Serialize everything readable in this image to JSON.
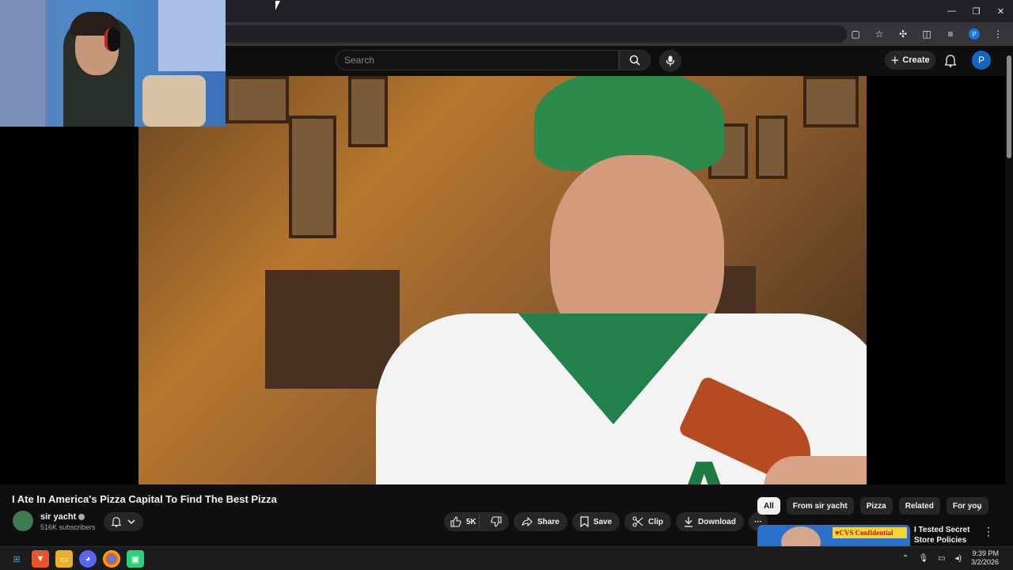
{
  "browser": {
    "window_controls": [
      "—",
      "❐",
      "✕"
    ]
  },
  "youtube": {
    "search_placeholder": "Search",
    "create_label": "Create",
    "avatar_letter": "P"
  },
  "video": {
    "title": "I Ate In America's Pizza Capital To Find The Best Pizza",
    "jersey_letter": "A"
  },
  "channel": {
    "name": "sir yacht",
    "subscribers": "516K subscribers"
  },
  "actions": {
    "likes": "5K",
    "share": "Share",
    "save": "Save",
    "clip": "Clip",
    "download": "Download",
    "more": "···"
  },
  "chips": [
    "All",
    "From sir yacht",
    "Pizza",
    "Related",
    "For you"
  ],
  "recommendation": {
    "title": "I Tested Secret Store Policies",
    "thumb_badge": "♥CVS Confidential"
  },
  "taskbar": {
    "time": "9:39 PM",
    "date": "3/2/2026"
  },
  "colors": {
    "accent": "#1565c0",
    "bg": "#0f0f0f",
    "pill": "#272727"
  }
}
